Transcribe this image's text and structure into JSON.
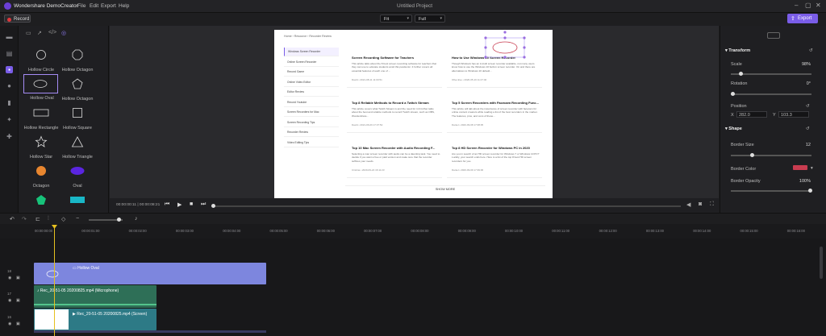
{
  "app": {
    "name": "Wondershare DemoCreator",
    "project_title": "Untitled Project"
  },
  "menu": [
    "File",
    "Edit",
    "Export",
    "Help"
  ],
  "toolbar": {
    "record_label": "Record",
    "fit_value": "Fit",
    "quality_value": "Full",
    "export_label": "Export"
  },
  "panel": {
    "shapes": [
      {
        "label": "Hollow Circle"
      },
      {
        "label": "Hollow Octagon"
      },
      {
        "label": "Hollow Oval"
      },
      {
        "label": "Hollow Octagon"
      },
      {
        "label": "Hollow Rectangle"
      },
      {
        "label": "Hollow Square"
      },
      {
        "label": "Hollow Star"
      },
      {
        "label": "Hollow Triangle"
      },
      {
        "label": "Octagon"
      },
      {
        "label": "Oval"
      },
      {
        "label": ""
      },
      {
        "label": ""
      }
    ]
  },
  "webpage": {
    "breadcrumb": [
      "Home",
      "Resource",
      "Recorder Review"
    ],
    "sidebar_items": [
      "Windows Screen Recorder",
      "Online Screen Recorder",
      "Record Game",
      "Online Video Editor",
      "Editor Review",
      "Record Youtube",
      "Screen Recorders for Mac",
      "Screen Recording Tips",
      "Recorder Review",
      "Video Editing Tips"
    ],
    "articles": [
      {
        "title": "Screen Recording Software for Teachers",
        "body": "This article talks about the 8 best screen recording software for teachers that they can use to educate students amid this pandemic. It further covers all essential features of each one of ...",
        "meta": "David • 2021-08-11 11:00:51"
      },
      {
        "title": "How to Use Windows 10 Screen Recorder",
        "body": "Though Windows has an in-built screen recorder available, not many users know how to use the Windows 10 built-in screen recorder. On and there are alternatives to Windows 10 default...",
        "meta": "Olive Eve • 2020-05-16 11:27:40"
      },
      {
        "title": "Top 8 Reliable Methods to Record a Twitch Stream",
        "body": "This article covers what Twitch Stream is and the need for it & further talks about the best and reliable methods to record Twitch stream, such as OBS, Wondershare...",
        "meta": "David • 2021-06-09 17:37:52"
      },
      {
        "title": "Top 5 Screen Recorders with Facecam Recording Func...",
        "body": "This article will talk about the importance of screen recorder with facecam for online content creators while reading a list of the best recorders in the market. The features, pros, and cons of these...",
        "meta": "Daniel • 2020-09-08 17:08:05"
      },
      {
        "title": "Top 10 Mac Screen Recorder with Audio Recording F...",
        "body": "Selecting a mac screen recorder with audio can be a daunting task. You need to decide if you want a free or paid version and make sure that the recorder suffices your needs.",
        "meta": "Cristina • 2020-09-22 16:11:23"
      },
      {
        "title": "Top 8 HD Screen Recorder for Windows PC in 2020",
        "body": "Are you in search of an HD screen recorder for Windows 7 or Windows 10 PC? Luckily, your search ends here. Here is a list of the top 8 best HD screen recorders for you.",
        "meta": "Daniel • 2020-09-09 17:39:06"
      }
    ],
    "show_more": "SHOW MORE"
  },
  "player": {
    "time": "00:00:00:11 | 00:00:08:21"
  },
  "properties": {
    "transform_header": "Transform",
    "scale_label": "Scale",
    "scale_value": "98%",
    "scale_pct": 0.1,
    "rotation_label": "Rotation",
    "rotation_value": "0°",
    "position_label": "Position",
    "x_label": "X",
    "x_value": "282.0",
    "y_label": "Y",
    "y_value": "103.3",
    "shape_header": "Shape",
    "border_size_label": "Border Size",
    "border_size_value": "12",
    "border_color_label": "Border Color",
    "border_color": "#c83c50",
    "border_opacity_label": "Border Opacity",
    "border_opacity_value": "100%"
  },
  "timeline": {
    "ticks": [
      "00:00:00:00",
      "00:00:01:00",
      "00:00:02:00",
      "00:00:03:00",
      "00:00:04:00",
      "00:00:05:00",
      "00:00:06:00",
      "00:00:07:00",
      "00:00:08:00",
      "00:00:09:00",
      "00:00:10:00",
      "00:00:11:00",
      "00:00:12:00",
      "00:00:13:00",
      "00:00:14:00",
      "00:00:15:00",
      "00:00:16:00"
    ],
    "tracks": [
      {
        "number": "18",
        "clip_label": "Hollow Oval",
        "color": "#7d86de"
      },
      {
        "number": "17",
        "clip_label": "Rec_20-51-05 20200825.mp4 (Microphone)",
        "color": "#2e6f57"
      },
      {
        "number": "16",
        "clip_label": "Rec_20-51-05 20200825.mp4 (Screen)",
        "color": "#2d7a86"
      }
    ]
  },
  "colors": {
    "accent": "#7a5de8",
    "record": "#e0373c",
    "shape_fill_orange": "#e8862f",
    "shape_fill_purple": "#5a25e0",
    "shape_fill_green": "#17c27a",
    "shape_fill_teal": "#19b7c7"
  }
}
